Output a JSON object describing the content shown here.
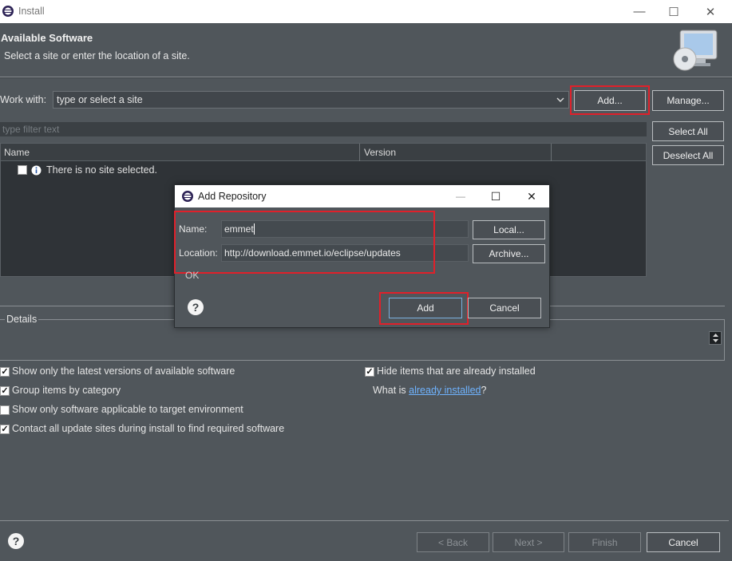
{
  "window": {
    "title": "Install",
    "minimize": "—",
    "maximize": "☐",
    "close": "✕"
  },
  "header": {
    "title": "Available Software",
    "subtitle": "Select a site or enter the location of a site."
  },
  "work_with": {
    "label": "Work with:",
    "value": "type or select a site",
    "add_label": "Add...",
    "manage_label": "Manage..."
  },
  "filter": {
    "placeholder": "type filter text"
  },
  "buttons": {
    "select_all": "Select All",
    "deselect_all": "Deselect All"
  },
  "table": {
    "columns": [
      "Name",
      "Version"
    ],
    "rows": [
      {
        "text": "There is no site selected."
      }
    ]
  },
  "details": {
    "label": "Details"
  },
  "options": {
    "latest_versions": {
      "label": "Show only the latest versions of available software",
      "checked": true
    },
    "group_by_category": {
      "label": "Group items by category",
      "checked": true
    },
    "target_env": {
      "label": "Show only software applicable to target environment",
      "checked": false
    },
    "contact_sites": {
      "label": "Contact all update sites during install to find required software",
      "checked": true
    },
    "hide_installed": {
      "label": "Hide items that are already installed",
      "checked": true
    },
    "what_is_prefix": "What is ",
    "what_is_link": "already installed",
    "what_is_suffix": "?"
  },
  "footer": {
    "back": "< Back",
    "next": "Next >",
    "finish": "Finish",
    "cancel": "Cancel"
  },
  "dialog": {
    "title": "Add Repository",
    "name_label": "Name:",
    "name_value": "emmet",
    "location_label": "Location:",
    "location_value": "http://download.emmet.io/eclipse/updates",
    "local_label": "Local...",
    "archive_label": "Archive...",
    "status": "OK",
    "add_label": "Add",
    "cancel_label": "Cancel"
  },
  "colors": {
    "highlight": "#e0202a",
    "link": "#6fb3ff",
    "background": "#50565b"
  }
}
